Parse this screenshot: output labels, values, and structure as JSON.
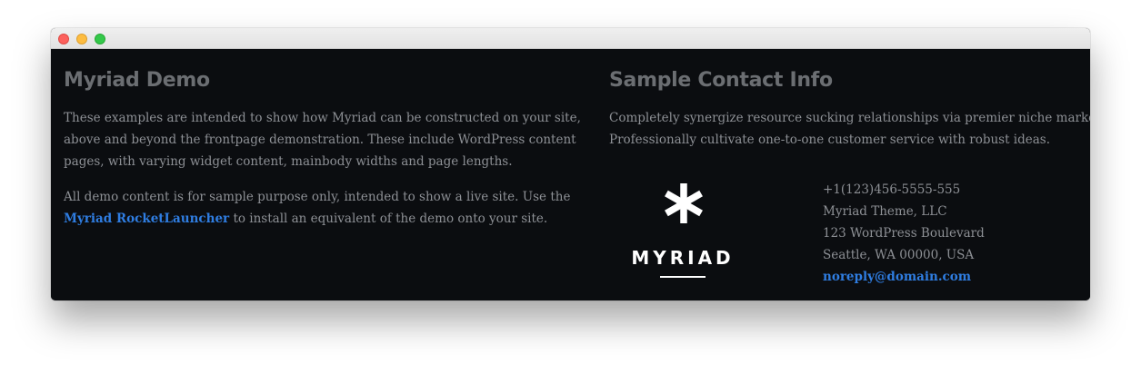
{
  "window": {
    "controls": [
      "close",
      "minimize",
      "maximize"
    ]
  },
  "left": {
    "title": "Myriad Demo",
    "para1_lines": [
      "These examples are intended to show how Myriad can be constructed on your site,",
      "above and beyond the frontpage demonstration. These include WordPress content",
      "pages, with varying widget content, mainbody widths and page lengths."
    ],
    "para2_line1": "All demo content is for sample purpose only, intended to show a live site. Use the",
    "para2_link": "Myriad RocketLauncher",
    "para2_rest": " to install an equivalent of the demo onto your site."
  },
  "right": {
    "title": "Sample Contact Info",
    "para_lines": [
      "Completely synergize resource sucking relationships via premier niche markets.",
      "Professionally cultivate one-to-one customer service with robust ideas."
    ],
    "logo_text": "MYRIAD",
    "contact": {
      "phone": "+1(123)456-5555-555",
      "company": "Myriad Theme, LLC",
      "street": "123 WordPress Boulevard",
      "city": "Seattle, WA 00000, USA",
      "email": "noreply@domain.com"
    }
  },
  "colors": {
    "background": "#0b0d10",
    "heading": "#6b6e72",
    "body_text": "#8d9095",
    "link": "#2f7de1"
  }
}
